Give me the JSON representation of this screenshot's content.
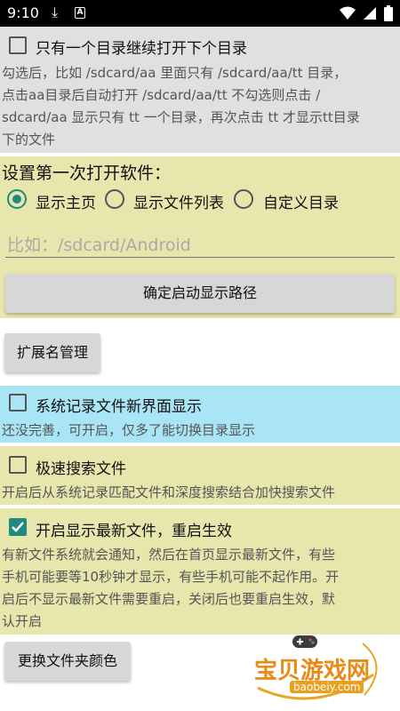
{
  "status_bar": {
    "time": "9:10"
  },
  "section_auto_open": {
    "checkbox_label": "只有一个目录继续打开下个目录",
    "checked": false,
    "desc_lines": [
      "勾选后，比如 /sdcard/aa 里面只有 /sdcard/aa/tt 目录，",
      "点击aa目录后自动打开 /sdcard/aa/tt 不勾选则点击 /",
      "sdcard/aa 显示只有 tt 一个目录，再次点击 tt 才显示tt目录",
      "下的文件"
    ]
  },
  "section_start": {
    "title": "设置第一次打开软件：",
    "radios": [
      {
        "label": "显示主页",
        "selected": true
      },
      {
        "label": "显示文件列表",
        "selected": false
      },
      {
        "label": "自定义目录",
        "selected": false
      }
    ],
    "path_placeholder": "比如：/sdcard/Android",
    "confirm_button": "确定启动显示路径"
  },
  "ext_button": "扩展名管理",
  "section_system_record": {
    "checkbox_label": "系统记录文件新界面显示",
    "checked": false,
    "desc": "还没完善，可开启，仅多了能切换目录显示"
  },
  "section_fast_search": {
    "checkbox_label": "极速搜索文件",
    "checked": false,
    "desc": "开启后从系统记录匹配文件和深度搜索结合加快搜索文件"
  },
  "section_newest": {
    "checkbox_label": "开启显示最新文件，重启生效",
    "checked": true,
    "desc_lines": [
      "有新文件系统就会通知，然后在首页显示最新文件，有些",
      "手机可能要等10秒钟才显示，有些手机可能不起作用。开",
      "启后不显示最新文件需要重启，关闭后也要重启生效，默",
      "认开启"
    ]
  },
  "folder_color_button": "更换文件夹颜色",
  "watermark": {
    "title": "宝贝游戏网",
    "url": "baobeiy.com"
  },
  "colors": {
    "accent": "#1f8a7e",
    "gray_panel": "#e0e0e0",
    "yellow_panel": "#e6e6ad",
    "cyan_panel": "#a9e5f4"
  }
}
